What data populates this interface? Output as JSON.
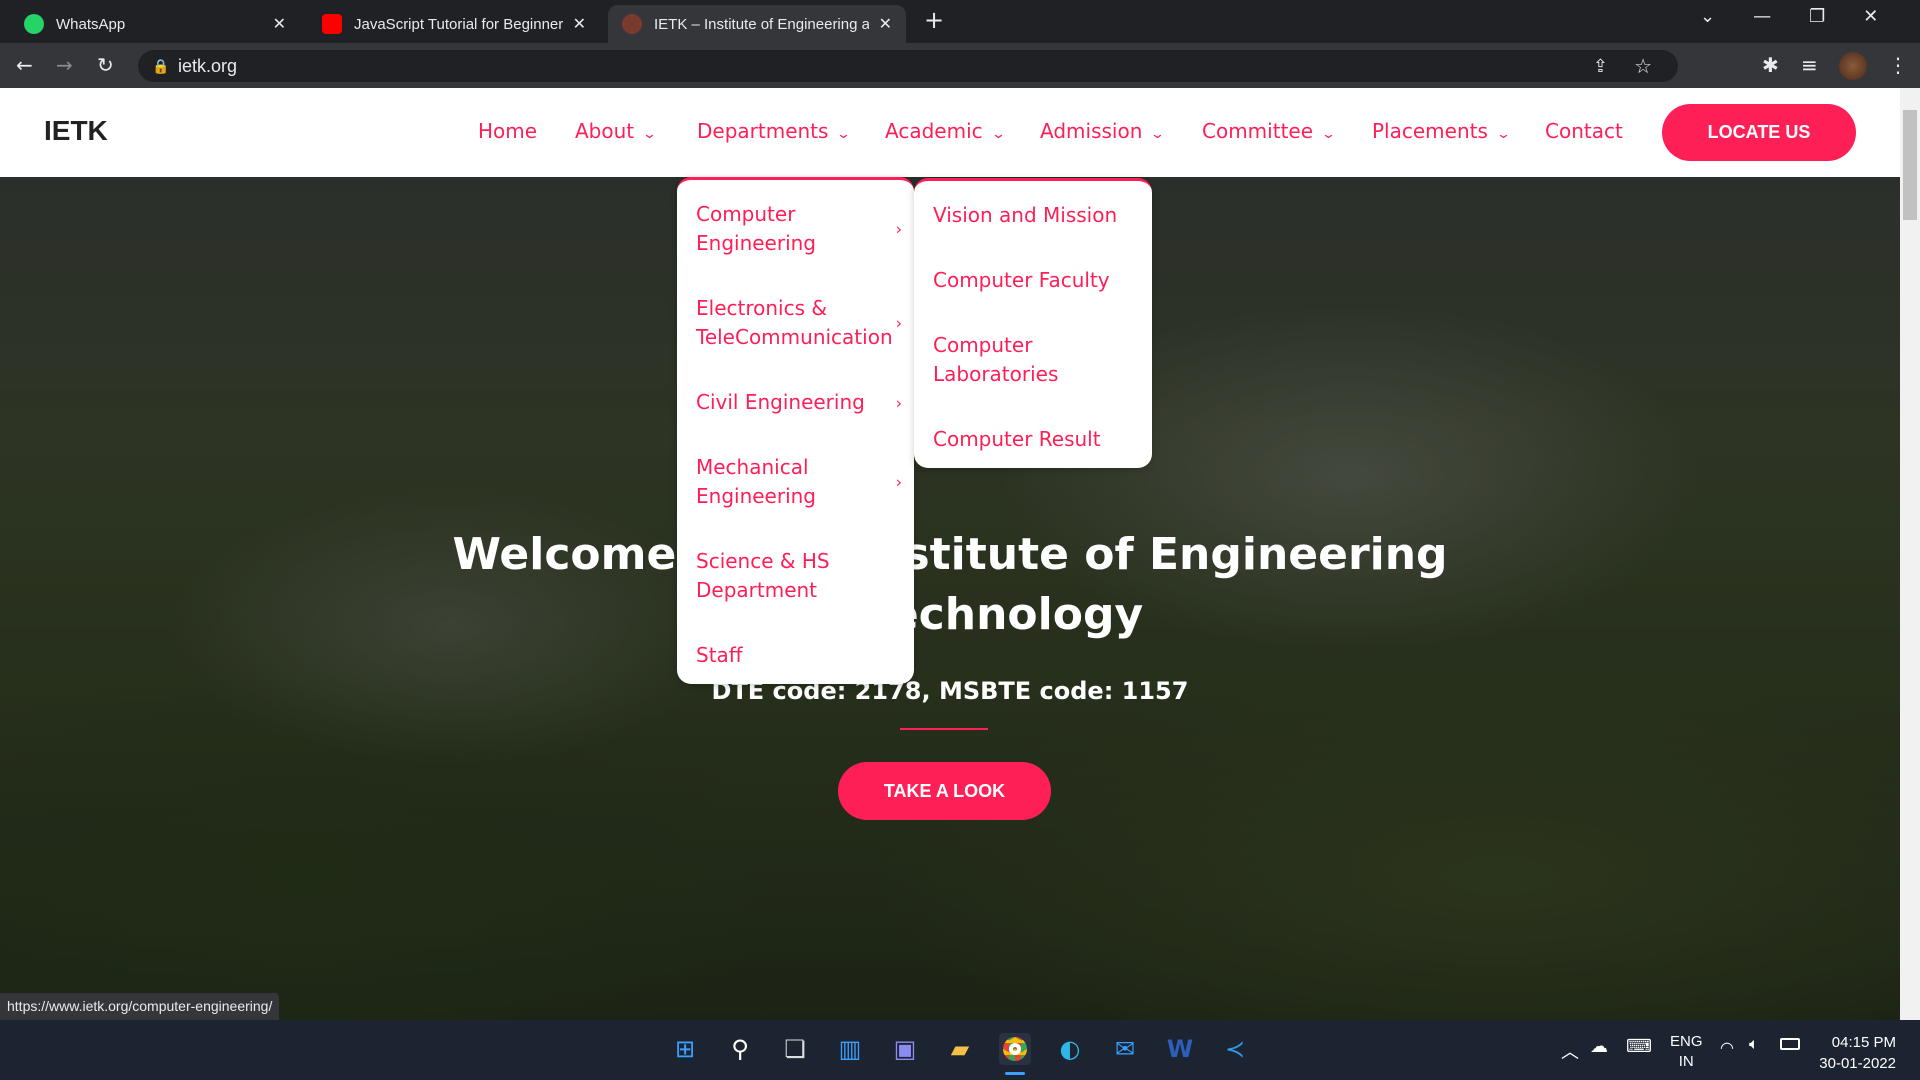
{
  "browser": {
    "tabs": [
      {
        "title": "WhatsApp",
        "icon": "whatsapp-icon",
        "color": "#25d366"
      },
      {
        "title": "JavaScript Tutorial for Beginners:",
        "icon": "youtube-icon",
        "color": "#ff0000"
      },
      {
        "title": "IETK – Institute of Engineering an",
        "icon": "ietk-favicon",
        "color": "#7a3b2e"
      }
    ],
    "new_tab": "+",
    "url": "ietk.org",
    "status_url": "https://www.ietk.org/computer-engineering/"
  },
  "site": {
    "logo": "IETK",
    "nav": [
      {
        "label": "Home",
        "dropdown": false
      },
      {
        "label": "About",
        "dropdown": true
      },
      {
        "label": "Departments",
        "dropdown": true
      },
      {
        "label": "Academic",
        "dropdown": true
      },
      {
        "label": "Admission",
        "dropdown": true
      },
      {
        "label": "Committee",
        "dropdown": true
      },
      {
        "label": "Placements",
        "dropdown": true
      },
      {
        "label": "Contact",
        "dropdown": false
      }
    ],
    "locate_button": "LOCATE US",
    "accent": "#ff1f57"
  },
  "departments_menu": [
    {
      "label": "Computer Engineering",
      "submenu": true
    },
    {
      "label": "Electronics & TeleCommunication",
      "submenu": true
    },
    {
      "label": "Civil Engineering",
      "submenu": true
    },
    {
      "label": "Mechanical Engineering",
      "submenu": true
    },
    {
      "label": "Science & HS Department",
      "submenu": false
    },
    {
      "label": "Staff",
      "submenu": false
    }
  ],
  "computer_submenu": [
    "Vision and Mission",
    "Computer Faculty",
    "Computer Laboratories",
    "Computer Result"
  ],
  "hero": {
    "title_line1": "Welcome to the Institute of Engineering",
    "title_line2": "and Technology",
    "codes": "DTE code: 2178, MSBTE code: 1157",
    "cta": "TAKE A LOOK"
  },
  "taskbar": {
    "lang": "ENG",
    "region": "IN",
    "time": "04:15 PM",
    "date": "30-01-2022"
  }
}
